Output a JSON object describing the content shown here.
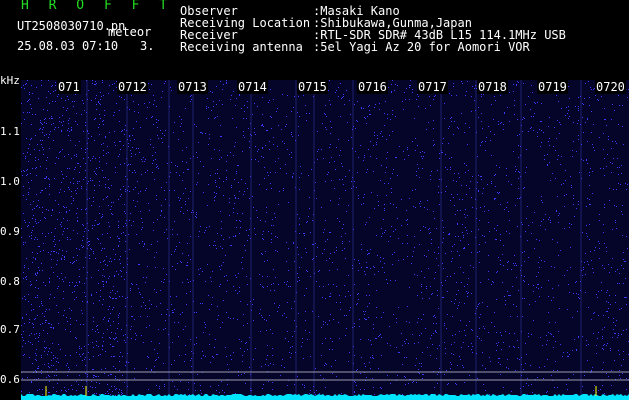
{
  "header": {
    "app_title": "H R O F F T",
    "file_name": "UT2508030710.pn",
    "mode": "meteor",
    "date_time": "25.08.03 07:10",
    "gain": "3.",
    "info": [
      {
        "label": "Observer",
        "value": ":Masaki Kano"
      },
      {
        "label": "Receiving Location",
        "value": ":Shibukawa,Gunma,Japan"
      },
      {
        "label": "Receiver",
        "value": ":RTL-SDR SDR# 43dB L15 114.1MHz USB"
      },
      {
        "label": "Receiving antenna",
        "value": ":5el Yagi Az 20 for Aomori VOR"
      }
    ]
  },
  "spectrogram": {
    "unit": "kHz",
    "y_ticks": [
      "1.1",
      "1.0",
      "0.9",
      "0.8",
      "0.7",
      "0.6"
    ],
    "x_ticks": [
      "071",
      "0712",
      "0713",
      "0714",
      "0715",
      "0716",
      "0717",
      "0718",
      "0719",
      "0720"
    ],
    "colors": {
      "background": "#05052a",
      "noise": "#3b3bff",
      "baseline": "#00e5ff",
      "marker": "#ffff00"
    }
  }
}
